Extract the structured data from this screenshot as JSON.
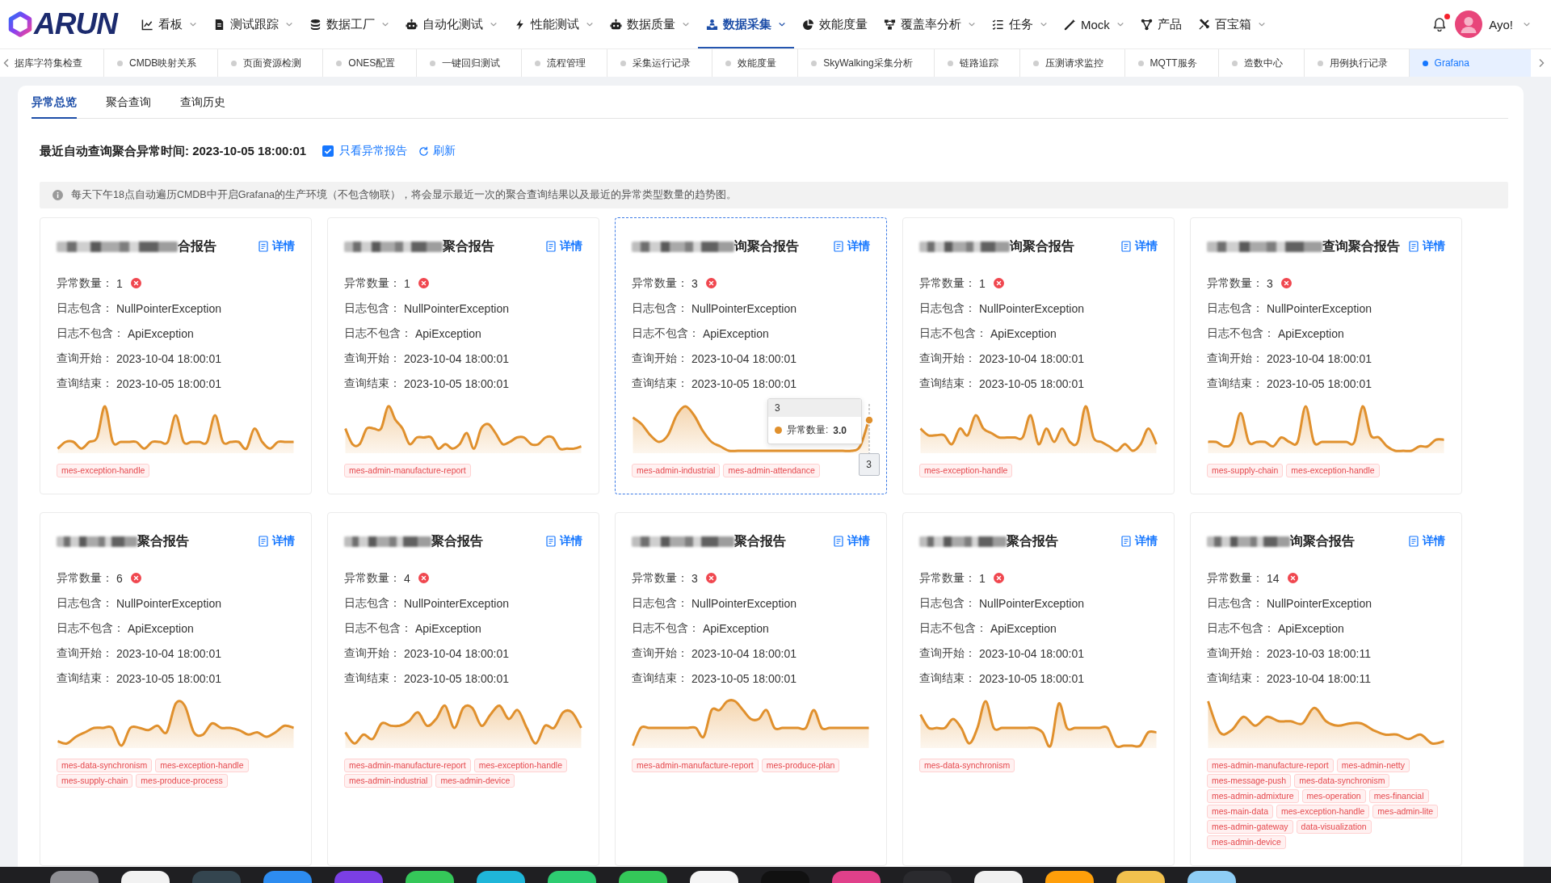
{
  "logo": {
    "text": "ARUN"
  },
  "nav": {
    "items": [
      {
        "label": "看板",
        "dropdown": true,
        "selected": false
      },
      {
        "label": "测试跟踪",
        "dropdown": true,
        "selected": false
      },
      {
        "label": "数据工厂",
        "dropdown": true,
        "selected": false
      },
      {
        "label": "自动化测试",
        "dropdown": true,
        "selected": false
      },
      {
        "label": "性能测试",
        "dropdown": true,
        "selected": false
      },
      {
        "label": "数据质量",
        "dropdown": true,
        "selected": false
      },
      {
        "label": "数据采集",
        "dropdown": true,
        "selected": true
      },
      {
        "label": "效能度量",
        "dropdown": false,
        "selected": false
      },
      {
        "label": "覆盖率分析",
        "dropdown": true,
        "selected": false
      },
      {
        "label": "任务",
        "dropdown": true,
        "selected": false
      },
      {
        "label": "Mock",
        "dropdown": true,
        "selected": false
      },
      {
        "label": "产品",
        "dropdown": false,
        "selected": false
      },
      {
        "label": "百宝箱",
        "dropdown": true,
        "selected": false
      }
    ],
    "user": {
      "name": "Ayo!",
      "notification": true
    }
  },
  "tab_strip": {
    "items": [
      {
        "label": "据库字符集检查",
        "dot": false,
        "selected": false
      },
      {
        "label": "CMDB映射关系",
        "dot": true,
        "selected": false
      },
      {
        "label": "页面资源检测",
        "dot": true,
        "selected": false
      },
      {
        "label": "ONES配置",
        "dot": true,
        "selected": false
      },
      {
        "label": "一键回归测试",
        "dot": true,
        "selected": false
      },
      {
        "label": "流程管理",
        "dot": true,
        "selected": false
      },
      {
        "label": "采集运行记录",
        "dot": true,
        "selected": false
      },
      {
        "label": "效能度量",
        "dot": true,
        "selected": false
      },
      {
        "label": "SkyWalking采集分析",
        "dot": true,
        "selected": false
      },
      {
        "label": "链路追踪",
        "dot": true,
        "selected": false
      },
      {
        "label": "压测请求监控",
        "dot": true,
        "selected": false
      },
      {
        "label": "MQTT服务",
        "dot": true,
        "selected": false
      },
      {
        "label": "造数中心",
        "dot": true,
        "selected": false
      },
      {
        "label": "用例执行记录",
        "dot": true,
        "selected": false
      },
      {
        "label": "Grafana",
        "dot": true,
        "selected": true
      }
    ]
  },
  "panel": {
    "tabs": [
      {
        "label": "异常总览",
        "selected": true
      },
      {
        "label": "聚合查询",
        "selected": false
      },
      {
        "label": "查询历史",
        "selected": false
      }
    ],
    "summary": {
      "text": "最近自动查询聚合异常时间: 2023-10-05 18:00:01",
      "filter": {
        "label": "只看异常报告",
        "checked": true
      },
      "refresh": "刷新"
    },
    "notice": "每天下午18点自动遍历CMDB中开启Grafana的生产环境（不包含物联），将会显示最近一次的聚合查询结果以及最近的异常类型数量的趋势图。",
    "cards": [
      {
        "title": "合报告",
        "details": "详情",
        "focused": false,
        "fields": [
          {
            "kind": "count",
            "label": "异常数量：",
            "value": "1"
          },
          {
            "kind": "text",
            "label": "日志包含：",
            "value": "NullPointerException"
          },
          {
            "kind": "text",
            "label": "日志不包含：",
            "value": "ApiException"
          },
          {
            "kind": "text",
            "label": "查询开始：",
            "value": "2023-10-04 18:00:01"
          },
          {
            "kind": "text",
            "label": "查询结束：",
            "value": "2023-10-05 18:00:01"
          }
        ],
        "tags": [
          "mes-exception-handle"
        ]
      },
      {
        "title": "聚合报告",
        "details": "详情",
        "focused": false,
        "fields": [
          {
            "kind": "count",
            "label": "异常数量：",
            "value": "1"
          },
          {
            "kind": "text",
            "label": "日志包含：",
            "value": "NullPointerException"
          },
          {
            "kind": "text",
            "label": "日志不包含：",
            "value": "ApiException"
          },
          {
            "kind": "text",
            "label": "查询开始：",
            "value": "2023-10-04 18:00:01"
          },
          {
            "kind": "text",
            "label": "查询结束：",
            "value": "2023-10-05 18:00:01"
          }
        ],
        "tags": [
          "mes-admin-manufacture-report"
        ]
      },
      {
        "title": "询聚合报告",
        "details": "详情",
        "focused": true,
        "fields": [
          {
            "kind": "count",
            "label": "异常数量：",
            "value": "3"
          },
          {
            "kind": "text",
            "label": "日志包含：",
            "value": "NullPointerException"
          },
          {
            "kind": "text",
            "label": "日志不包含：",
            "value": "ApiException"
          },
          {
            "kind": "text",
            "label": "查询开始：",
            "value": "2023-10-04 18:00:01"
          },
          {
            "kind": "text",
            "label": "查询结束：",
            "value": "2023-10-05 18:00:01"
          }
        ],
        "tooltip": {
          "title": "3",
          "label": "异常数量:",
          "value": "3.0",
          "axis_label": "3"
        },
        "tags": [
          "mes-admin-industrial",
          "mes-admin-attendance"
        ]
      },
      {
        "title": "询聚合报告",
        "details": "详情",
        "focused": false,
        "fields": [
          {
            "kind": "count",
            "label": "异常数量：",
            "value": "1"
          },
          {
            "kind": "text",
            "label": "日志包含：",
            "value": "NullPointerException"
          },
          {
            "kind": "text",
            "label": "日志不包含：",
            "value": "ApiException"
          },
          {
            "kind": "text",
            "label": "查询开始：",
            "value": "2023-10-04 18:00:01"
          },
          {
            "kind": "text",
            "label": "查询结束：",
            "value": "2023-10-05 18:00:01"
          }
        ],
        "tags": [
          "mes-exception-handle"
        ]
      },
      {
        "title": "查询聚合报告",
        "details": "详情",
        "focused": false,
        "fields": [
          {
            "kind": "count",
            "label": "异常数量：",
            "value": "3"
          },
          {
            "kind": "text",
            "label": "日志包含：",
            "value": "NullPointerException"
          },
          {
            "kind": "text",
            "label": "日志不包含：",
            "value": "ApiException"
          },
          {
            "kind": "text",
            "label": "查询开始：",
            "value": "2023-10-04 18:00:01"
          },
          {
            "kind": "text",
            "label": "查询结束：",
            "value": "2023-10-05 18:00:01"
          }
        ],
        "tags": [
          "mes-supply-chain",
          "mes-exception-handle"
        ]
      },
      {
        "title": "聚合报告",
        "details": "详情",
        "focused": false,
        "fields": [
          {
            "kind": "count",
            "label": "异常数量：",
            "value": "6"
          },
          {
            "kind": "text",
            "label": "日志包含：",
            "value": "NullPointerException"
          },
          {
            "kind": "text",
            "label": "日志不包含：",
            "value": "ApiException"
          },
          {
            "kind": "text",
            "label": "查询开始：",
            "value": "2023-10-04 18:00:01"
          },
          {
            "kind": "text",
            "label": "查询结束：",
            "value": "2023-10-05 18:00:01"
          }
        ],
        "tags": [
          "mes-data-synchronism",
          "mes-exception-handle",
          "mes-supply-chain",
          "mes-produce-process"
        ]
      },
      {
        "title": "聚合报告",
        "details": "详情",
        "focused": false,
        "fields": [
          {
            "kind": "count",
            "label": "异常数量：",
            "value": "4"
          },
          {
            "kind": "text",
            "label": "日志包含：",
            "value": "NullPointerException"
          },
          {
            "kind": "text",
            "label": "日志不包含：",
            "value": "ApiException"
          },
          {
            "kind": "text",
            "label": "查询开始：",
            "value": "2023-10-04 18:00:01"
          },
          {
            "kind": "text",
            "label": "查询结束：",
            "value": "2023-10-05 18:00:01"
          }
        ],
        "tags": [
          "mes-admin-manufacture-report",
          "mes-exception-handle",
          "mes-admin-industrial",
          "mes-admin-device"
        ]
      },
      {
        "title": "聚合报告",
        "details": "详情",
        "focused": false,
        "fields": [
          {
            "kind": "count",
            "label": "异常数量：",
            "value": "3"
          },
          {
            "kind": "text",
            "label": "日志包含：",
            "value": "NullPointerException"
          },
          {
            "kind": "text",
            "label": "日志不包含：",
            "value": "ApiException"
          },
          {
            "kind": "text",
            "label": "查询开始：",
            "value": "2023-10-04 18:00:01"
          },
          {
            "kind": "text",
            "label": "查询结束：",
            "value": "2023-10-05 18:00:01"
          }
        ],
        "tags": [
          "mes-admin-manufacture-report",
          "mes-produce-plan"
        ]
      },
      {
        "title": "聚合报告",
        "details": "详情",
        "focused": false,
        "fields": [
          {
            "kind": "count",
            "label": "异常数量：",
            "value": "1"
          },
          {
            "kind": "text",
            "label": "日志包含：",
            "value": "NullPointerException"
          },
          {
            "kind": "text",
            "label": "日志不包含：",
            "value": "ApiException"
          },
          {
            "kind": "text",
            "label": "查询开始：",
            "value": "2023-10-04 18:00:01"
          },
          {
            "kind": "text",
            "label": "查询结束：",
            "value": "2023-10-05 18:00:01"
          }
        ],
        "tags": [
          "mes-data-synchronism"
        ]
      },
      {
        "title": "询聚合报告",
        "details": "详情",
        "focused": false,
        "fields": [
          {
            "kind": "count",
            "label": "异常数量：",
            "value": "14"
          },
          {
            "kind": "text",
            "label": "日志包含：",
            "value": "NullPointerException"
          },
          {
            "kind": "text",
            "label": "日志不包含：",
            "value": "ApiException"
          },
          {
            "kind": "text",
            "label": "查询开始：",
            "value": "2023-10-03 18:00:11"
          },
          {
            "kind": "text",
            "label": "查询结束：",
            "value": "2023-10-04 18:00:11"
          }
        ],
        "tags": [
          "mes-admin-manufacture-report",
          "mes-admin-netty",
          "mes-message-push",
          "mes-data-synchronism",
          "mes-admin-admixture",
          "mes-operation",
          "mes-financial",
          "mes-main-data",
          "mes-exception-handle",
          "mes-admin-lite",
          "mes-admin-gateway",
          "data-visualization",
          "mes-admin-device"
        ]
      }
    ]
  }
}
